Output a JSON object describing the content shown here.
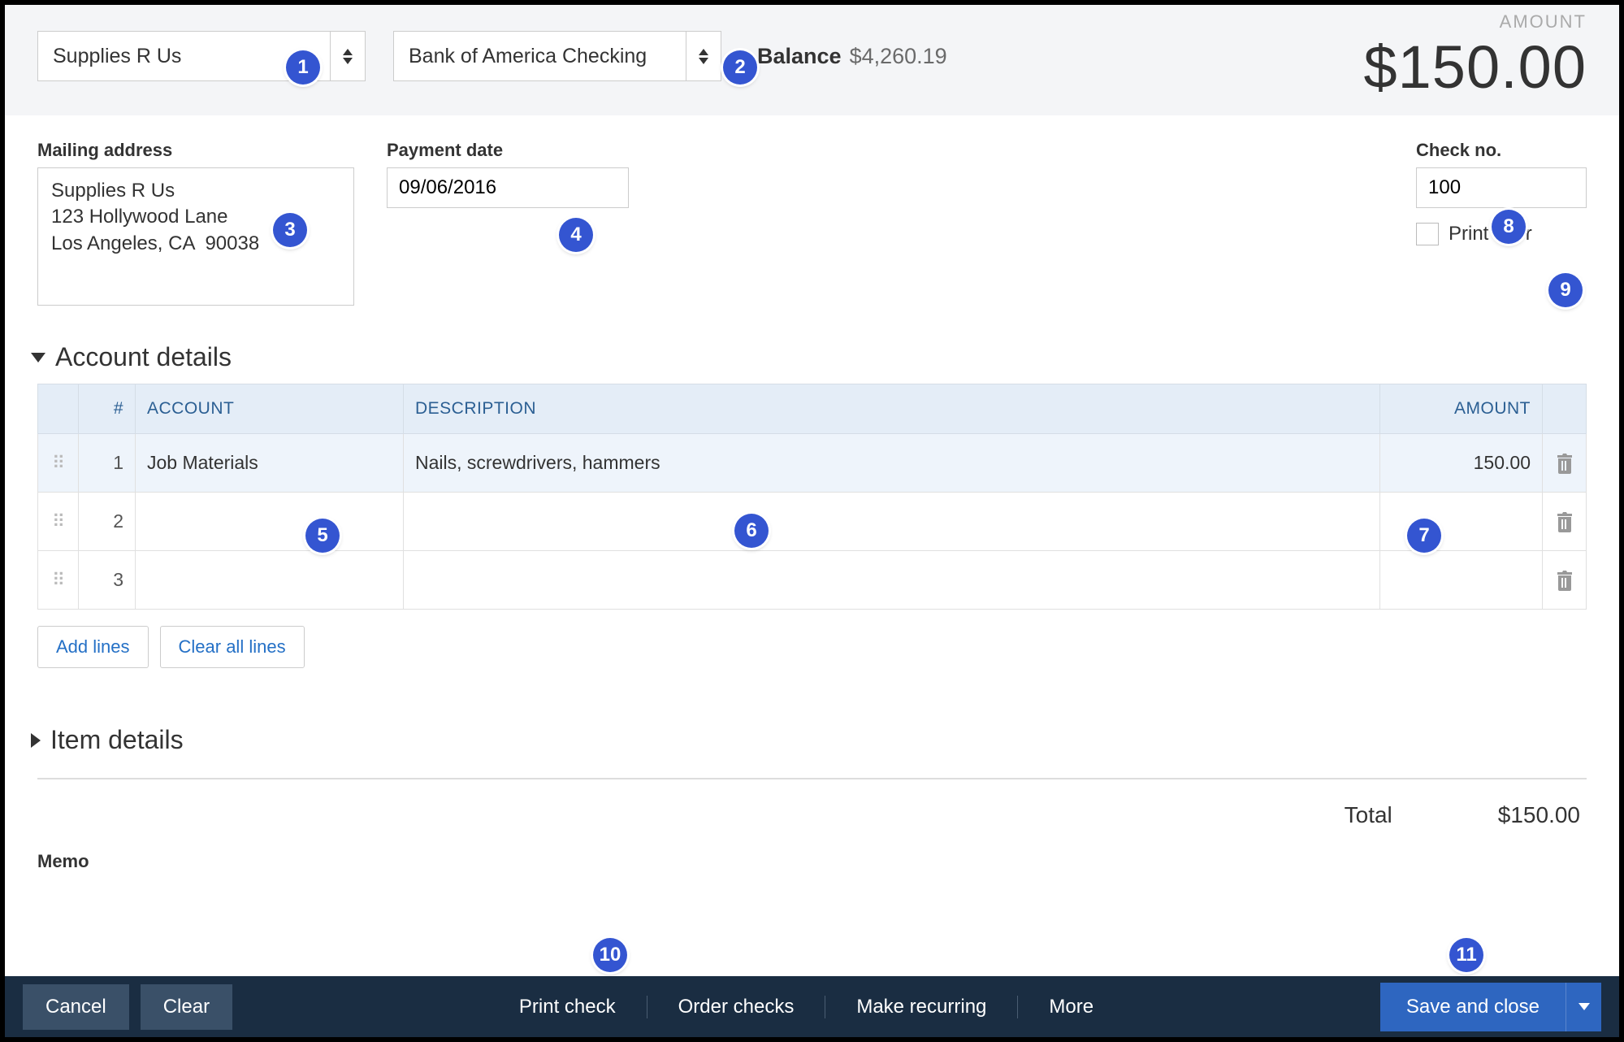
{
  "header": {
    "payee": "Supplies R Us",
    "account": "Bank of America Checking",
    "balance_label": "Balance",
    "balance_value": "$4,260.19",
    "amount_label": "AMOUNT",
    "amount_value": "$150.00"
  },
  "form": {
    "mailing_label": "Mailing address",
    "mailing_value": "Supplies R Us\n123 Hollywood Lane\nLos Angeles, CA  90038",
    "payment_date_label": "Payment date",
    "payment_date_value": "09/06/2016",
    "check_no_label": "Check no.",
    "check_no_value": "100",
    "print_later_label": "Print later"
  },
  "account_details": {
    "title": "Account details",
    "columns": {
      "num": "#",
      "account": "ACCOUNT",
      "description": "DESCRIPTION",
      "amount": "AMOUNT"
    },
    "rows": [
      {
        "num": "1",
        "account": "Job Materials",
        "description": "Nails, screwdrivers, hammers",
        "amount": "150.00"
      },
      {
        "num": "2",
        "account": "",
        "description": "",
        "amount": ""
      },
      {
        "num": "3",
        "account": "",
        "description": "",
        "amount": ""
      }
    ],
    "add_lines": "Add lines",
    "clear_all": "Clear all lines"
  },
  "item_details": {
    "title": "Item details"
  },
  "totals": {
    "label": "Total",
    "value": "$150.00"
  },
  "memo": {
    "label": "Memo"
  },
  "footer": {
    "cancel": "Cancel",
    "clear": "Clear",
    "print_check": "Print check",
    "order_checks": "Order checks",
    "make_recurring": "Make recurring",
    "more": "More",
    "save": "Save and close"
  },
  "annotations": [
    "1",
    "2",
    "3",
    "4",
    "5",
    "6",
    "7",
    "8",
    "9",
    "10",
    "11"
  ]
}
